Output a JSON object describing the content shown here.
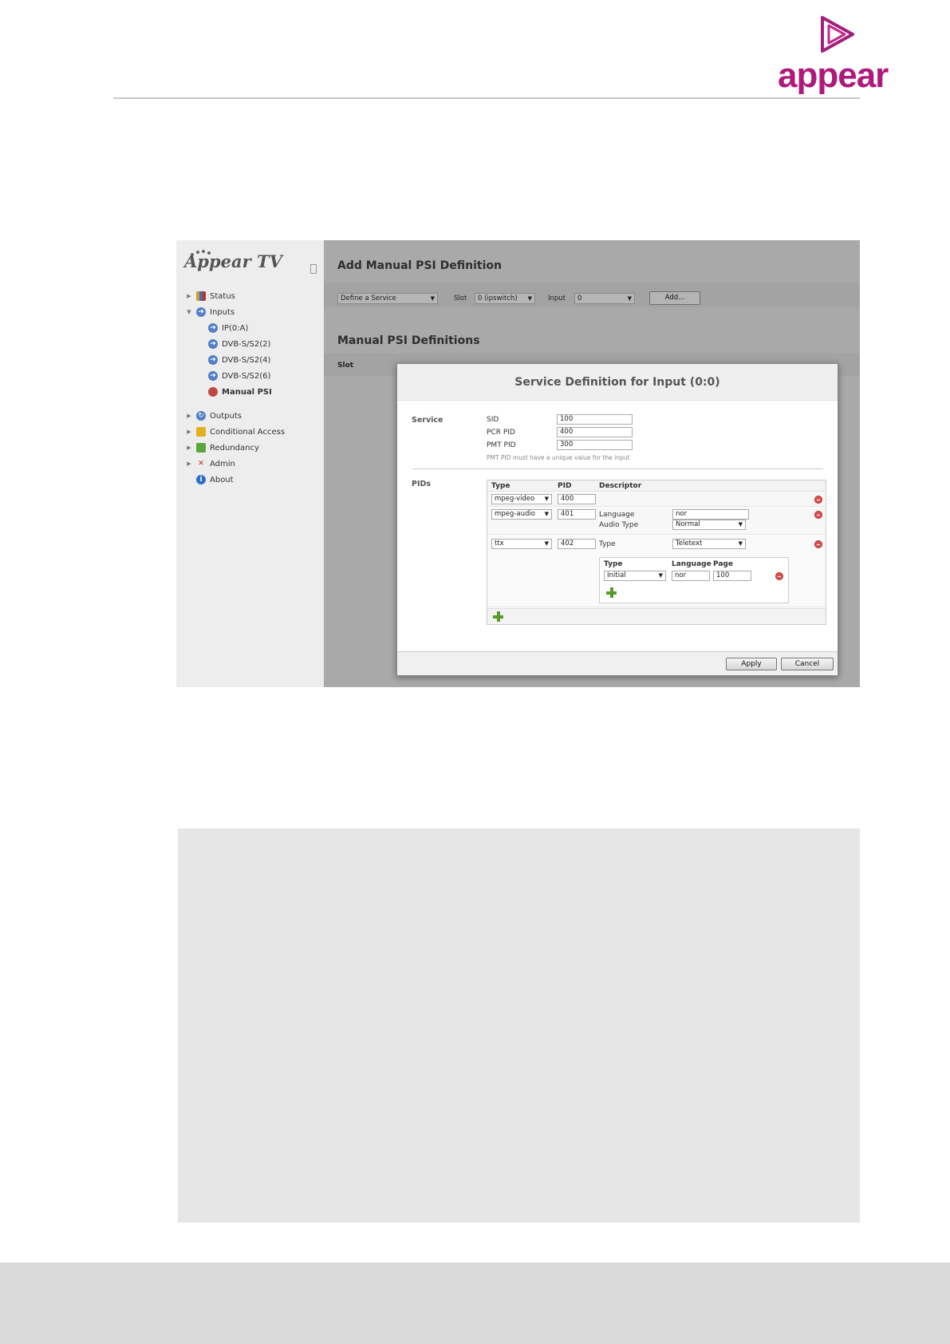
{
  "doc": {
    "logo_text": "appear"
  },
  "sidebar": {
    "brand": "Appear TV",
    "items": [
      {
        "label": "Status"
      },
      {
        "label": "Inputs"
      },
      {
        "label": "IP(0:A)"
      },
      {
        "label": "DVB-S/S2(2)"
      },
      {
        "label": "DVB-S/S2(4)"
      },
      {
        "label": "DVB-S/S2(6)"
      },
      {
        "label": "Manual PSI"
      },
      {
        "label": "Outputs"
      },
      {
        "label": "Conditional Access"
      },
      {
        "label": "Redundancy"
      },
      {
        "label": "Admin"
      },
      {
        "label": "About"
      }
    ]
  },
  "main": {
    "title": "Add Manual PSI Definition",
    "define_select": "Define a Service",
    "slot_label": "Slot",
    "slot_value": "0 (ipswitch)",
    "input_label": "Input",
    "input_value": "0",
    "add_button": "Add...",
    "definitions_title": "Manual PSI Definitions",
    "slot_column": "Slot"
  },
  "modal": {
    "title": "Service Definition for Input (0:0)",
    "service_section": "Service",
    "sid_label": "SID",
    "sid_value": "100",
    "pcr_label": "PCR PID",
    "pcr_value": "400",
    "pmt_label": "PMT PID",
    "pmt_value": "300",
    "pmt_hint": "PMT PID must have a unique value for the input",
    "pids_section": "PIDs",
    "columns": {
      "type": "Type",
      "pid": "PID",
      "descriptor": "Descriptor"
    },
    "rows": [
      {
        "type": "mpeg-video",
        "pid": "400"
      },
      {
        "type": "mpeg-audio",
        "pid": "401",
        "lang_label": "Language",
        "lang_value": "nor",
        "audio_label": "Audio Type",
        "audio_value": "Normal"
      },
      {
        "type": "ttx",
        "pid": "402",
        "type_label": "Type",
        "type_value": "Teletext"
      }
    ],
    "teletext": {
      "col_type": "Type",
      "col_language": "Language",
      "col_page": "Page",
      "type_value": "Initial",
      "language_value": "nor",
      "page_value": "100"
    },
    "apply": "Apply",
    "cancel": "Cancel"
  }
}
